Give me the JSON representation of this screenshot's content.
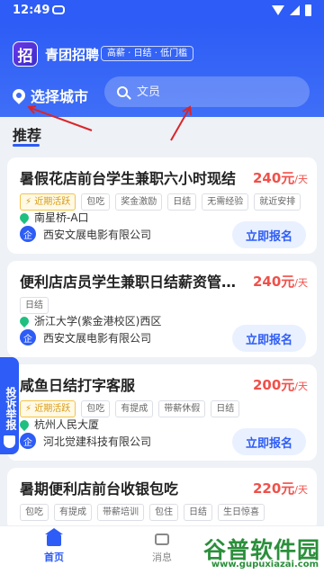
{
  "status_bar": {
    "time": "12:49"
  },
  "header": {
    "logo_text": "招",
    "app_name": "青团招聘",
    "slogan": "高薪 · 日结 · 低门槛",
    "city_label": "选择城市",
    "search_placeholder": "文员"
  },
  "section_title": "推荐",
  "jobs": [
    {
      "title": "暑假花店前台学生兼职六小时现结",
      "salary": "240元",
      "unit": "/天",
      "tags": [
        "近期活跃",
        "包吃",
        "奖金激励",
        "日结",
        "无需经验",
        "就近安排"
      ],
      "location": "南星桥-A口",
      "company": "西安文展电影有限公司",
      "apply": "立即报名"
    },
    {
      "title": "便利店店员学生兼职日结薪资管…",
      "salary": "240元",
      "unit": "/天",
      "tags": [
        "日结"
      ],
      "location": "浙江大学(紫金港校区)西区",
      "company": "西安文展电影有限公司",
      "apply": "立即报名"
    },
    {
      "title": "咸鱼日结打字客服",
      "salary": "200元",
      "unit": "/天",
      "tags": [
        "近期活跃",
        "包吃",
        "有提成",
        "带薪休假",
        "日结"
      ],
      "location": "杭州人民大厦",
      "company": "河北觉建科技有限公司",
      "apply": "立即报名"
    },
    {
      "title": "暑期便利店前台收银包吃",
      "salary": "220元",
      "unit": "/天",
      "tags": [
        "包吃",
        "有提成",
        "带薪培训",
        "包住",
        "日结",
        "生日惊喜"
      ]
    }
  ],
  "report_label": "投诉举报",
  "company_icon": "企",
  "tabbar": {
    "home": "首页",
    "messages": "消息"
  },
  "watermark": {
    "text": "谷普软件园",
    "url": "www.gupuxiazai.com"
  },
  "colors": {
    "primary": "#2d5cf6",
    "salary": "#f0504a",
    "active_tag": "#d79a12",
    "location_pin": "#1fbf80"
  }
}
